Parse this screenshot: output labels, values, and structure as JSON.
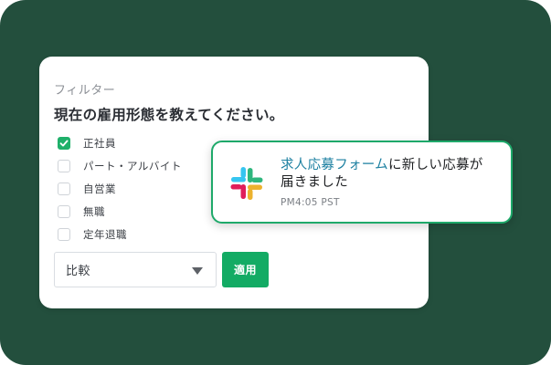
{
  "filter": {
    "title": "フィルター",
    "question": "現在の雇用形態を教えてください。",
    "options": [
      {
        "label": "正社員",
        "checked": true
      },
      {
        "label": "パート・アルバイト",
        "checked": false
      },
      {
        "label": "自営業",
        "checked": false
      },
      {
        "label": "無職",
        "checked": false
      },
      {
        "label": "定年退職",
        "checked": false
      }
    ],
    "select_value": "比較",
    "apply_label": "適用"
  },
  "notification": {
    "link_text": "求人応募フォーム",
    "message_line1_rest": "に新しい応募が",
    "message_line2": "届きました",
    "time": "PM4:05 PST"
  },
  "colors": {
    "background": "#234f3d",
    "accent_green": "#13ab64",
    "link_blue": "#1b7fa0",
    "slack_blue": "#36c5f0",
    "slack_green": "#2eb67d",
    "slack_yellow": "#ecb22e",
    "slack_red": "#e01e5a"
  },
  "icons": {
    "notification_app": "slack-logo-icon",
    "select_caret": "caret-down-icon",
    "checkbox_check": "check-icon"
  }
}
